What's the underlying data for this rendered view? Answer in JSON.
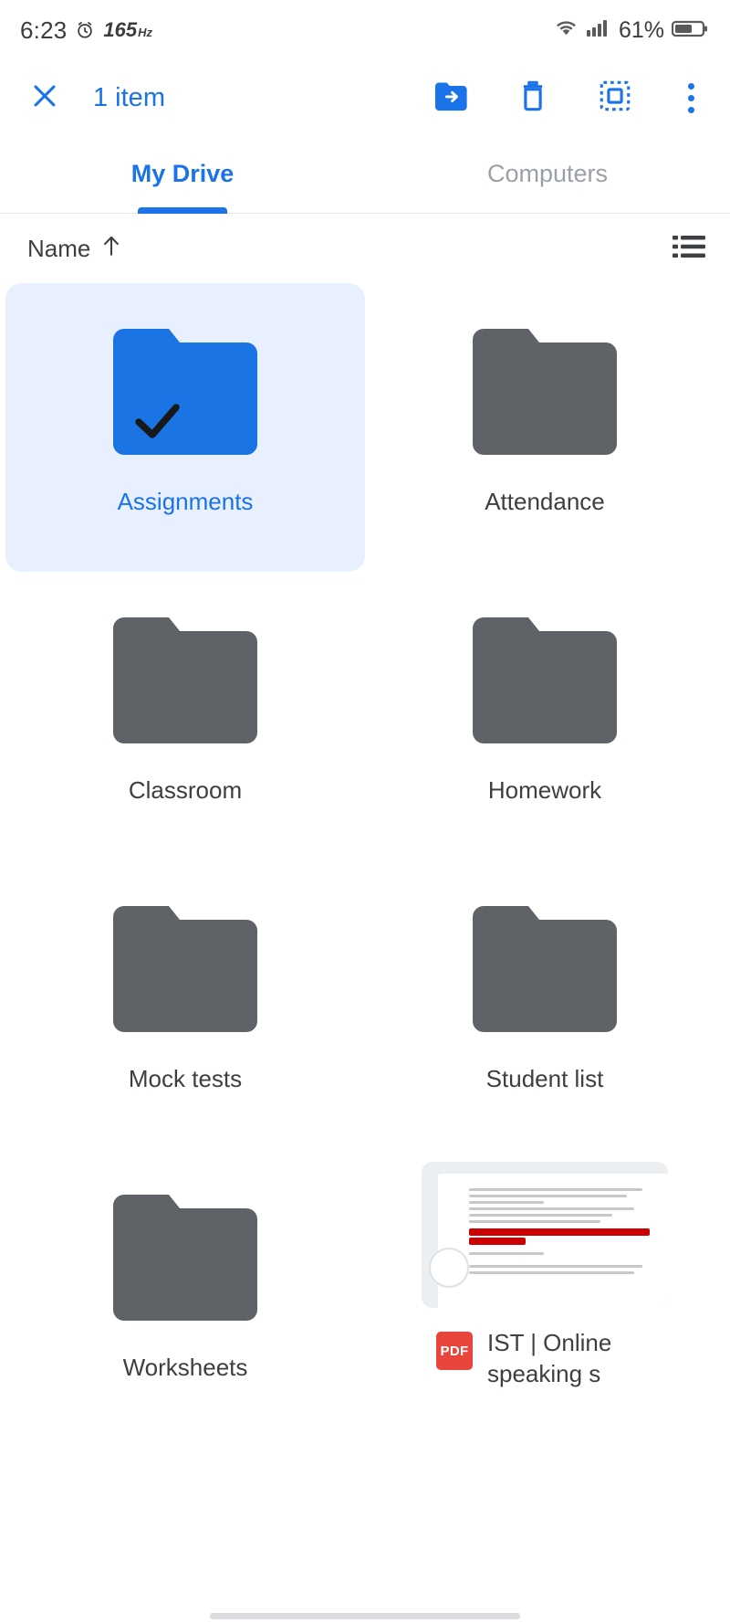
{
  "status_bar": {
    "time": "6:23",
    "refresh_rate_value": "165",
    "refresh_rate_unit": "Hz",
    "battery_percent": "61%",
    "icons": [
      "alarm-icon",
      "wifi-icon",
      "signal-icon",
      "battery-icon"
    ]
  },
  "action_bar": {
    "close_label": "close-icon",
    "selection_count": "1 item",
    "actions": [
      {
        "name": "move-to-folder-button",
        "label": "Move"
      },
      {
        "name": "delete-button",
        "label": "Delete"
      },
      {
        "name": "select-all-button",
        "label": "Select all"
      },
      {
        "name": "more-options-button",
        "label": "More options"
      }
    ]
  },
  "tabs": [
    {
      "label": "My Drive",
      "active": true
    },
    {
      "label": "Computers",
      "active": false
    }
  ],
  "sort": {
    "label": "Name",
    "direction_icon": "arrow-up-icon",
    "view_toggle_icon": "list-view-icon"
  },
  "colors": {
    "accent": "#1a73e8",
    "selected_bg": "#e8f0fe",
    "folder_gray": "#5f6368",
    "folder_blue": "#1b74e4",
    "pdf_red": "#e8453c",
    "text_primary": "#3c4043",
    "text_muted": "#9aa0a6"
  },
  "items": [
    {
      "name": "Assignments",
      "type": "folder",
      "selected": true
    },
    {
      "name": "Attendance",
      "type": "folder",
      "selected": false
    },
    {
      "name": "Classroom",
      "type": "folder",
      "selected": false
    },
    {
      "name": "Homework",
      "type": "folder",
      "selected": false
    },
    {
      "name": "Mock tests",
      "type": "folder",
      "selected": false
    },
    {
      "name": "Student list",
      "type": "folder",
      "selected": false
    },
    {
      "name": "Worksheets",
      "type": "folder",
      "selected": false
    },
    {
      "name": "IST | Online speaking s",
      "type": "pdf",
      "selected": false,
      "badge": "PDF"
    }
  ]
}
